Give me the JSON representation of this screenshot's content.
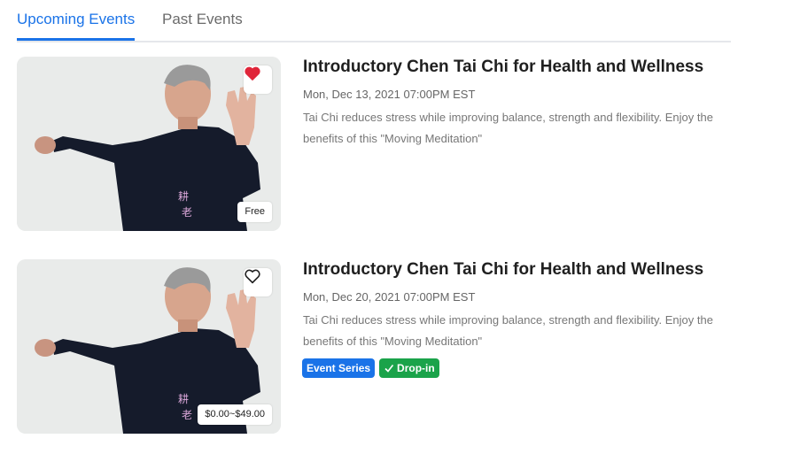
{
  "tabs": [
    {
      "label": "Upcoming Events",
      "active": true
    },
    {
      "label": "Past Events",
      "active": false
    }
  ],
  "events": [
    {
      "title": "Introductory Chen Tai Chi for Health and Wellness",
      "date": "Mon, Dec 13, 2021 07:00PM EST",
      "description": "Tai Chi reduces stress while improving balance, strength and flexibility. Enjoy the benefits of this \"Moving Meditation\"",
      "price": "Free",
      "favorite": true,
      "favorite_icon": "heart-filled-icon",
      "badges": []
    },
    {
      "title": "Introductory Chen Tai Chi for Health and Wellness",
      "date": "Mon, Dec 20, 2021 07:00PM EST",
      "description": "Tai Chi reduces stress while improving balance, strength and flexibility. Enjoy the benefits of this \"Moving Meditation\"",
      "price": "$0.00~$49.00",
      "favorite": false,
      "favorite_icon": "heart-outline-icon",
      "badges": [
        {
          "label": "Event Series",
          "color": "#1a73e8"
        },
        {
          "label": "Drop-in",
          "color": "#1aa34a",
          "icon": "check-icon"
        }
      ]
    }
  ],
  "colors": {
    "accent": "#1a73e8",
    "heart": "#e0263a",
    "dropin": "#1aa34a"
  }
}
